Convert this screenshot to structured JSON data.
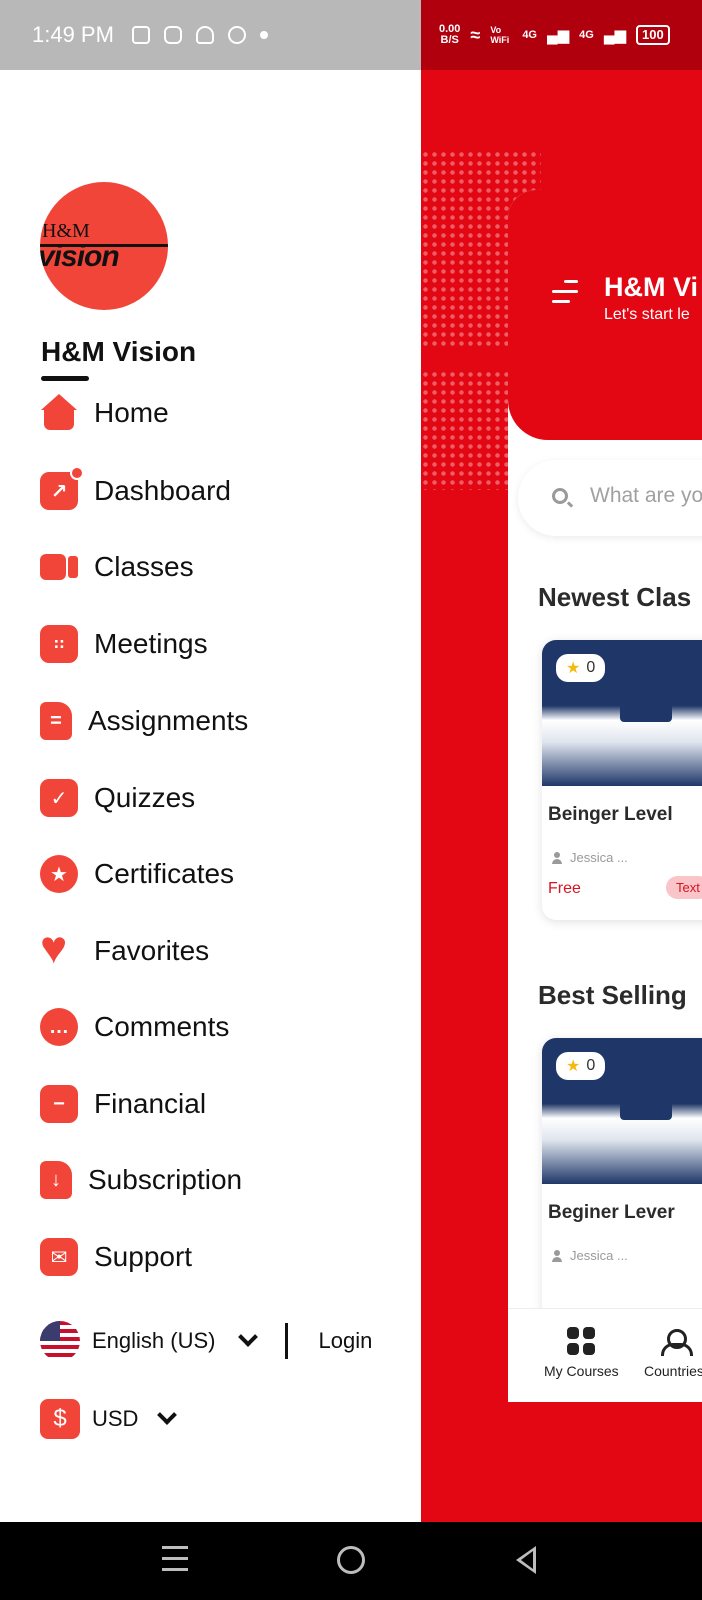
{
  "status_bar": {
    "time": "1:49 PM",
    "net_speed_value": "0.00",
    "net_speed_unit": "B/S",
    "vowifi": "Vo WiFi",
    "signal1": "4G",
    "signal2": "4G",
    "battery": "100"
  },
  "drawer": {
    "brand_name": "H&M Vision",
    "logo_text_top": "H&M",
    "logo_text_bottom": "vision",
    "menu": [
      {
        "label": "Home",
        "icon": "home-icon"
      },
      {
        "label": "Dashboard",
        "icon": "chart-icon"
      },
      {
        "label": "Classes",
        "icon": "video-icon"
      },
      {
        "label": "Meetings",
        "icon": "calendar-icon"
      },
      {
        "label": "Assignments",
        "icon": "document-icon"
      },
      {
        "label": "Quizzes",
        "icon": "check-icon"
      },
      {
        "label": "Certificates",
        "icon": "certificate-icon"
      },
      {
        "label": "Favorites",
        "icon": "heart-icon"
      },
      {
        "label": "Comments",
        "icon": "comment-icon"
      },
      {
        "label": "Financial",
        "icon": "wallet-icon"
      },
      {
        "label": "Subscription",
        "icon": "download-icon"
      },
      {
        "label": "Support",
        "icon": "mail-icon"
      }
    ],
    "language": "English (US)",
    "login": "Login",
    "currency": "USD",
    "currency_symbol": "$"
  },
  "background_app": {
    "header_title": "H&M Vi",
    "header_subtitle": "Let's start le",
    "search_placeholder": "What are you",
    "section_newest": "Newest Clas",
    "section_best": "Best Selling",
    "cards": [
      {
        "title": "Beinger  Level",
        "rating": "0",
        "author": "Jessica ...",
        "price": "Free",
        "badge": "Text"
      },
      {
        "title": "Beginer Lever",
        "rating": "0",
        "author": "Jessica ..."
      }
    ],
    "bottom_nav": [
      "My Courses",
      "Countries"
    ]
  },
  "colors": {
    "accent_red": "#e30613",
    "icon_red": "#f2453a"
  }
}
